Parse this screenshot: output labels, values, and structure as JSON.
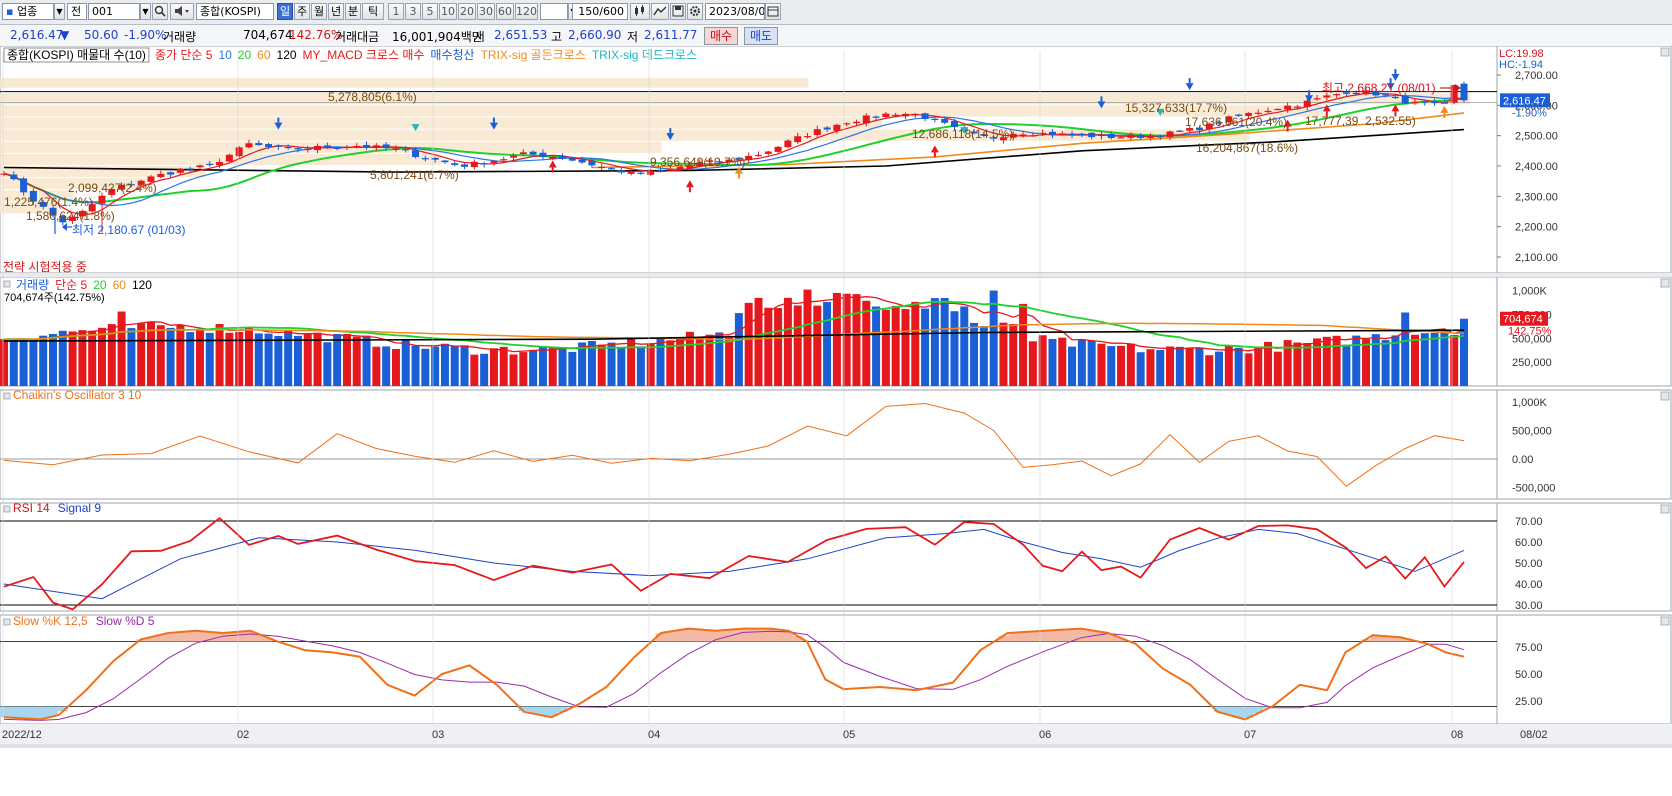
{
  "toolbar": {
    "market_type": "업종",
    "period_type": "전",
    "code": "001",
    "name": "종합(KOSPI)",
    "periods": [
      "일",
      "주",
      "월",
      "년",
      "분",
      "틱"
    ],
    "active_period": "일",
    "intervals": [
      "1",
      "3",
      "5",
      "10",
      "20",
      "30",
      "60",
      "120"
    ],
    "count": "150/600",
    "date": "2023/08/02",
    "icons": [
      "search-icon",
      "speaker-icon",
      "candle-type-icon",
      "link-icon",
      "save-icon",
      "gear-icon",
      "calendar-icon"
    ]
  },
  "quote": {
    "price": "2,616.47",
    "change_arrow": "▼",
    "change": "50.60",
    "change_pct": "-1.90%",
    "volume_label": "거래량",
    "volume": "704,674",
    "volume_ratio": "142.76%",
    "amount_label": "거래대금",
    "amount": "16,001,904백만",
    "open_label": "시",
    "open": "2,651.53",
    "high_label": "고",
    "high": "2,660.90",
    "low_label": "저",
    "low": "2,611.77",
    "buy_label": "매수",
    "sell_label": "매도"
  },
  "colors": {
    "up": "#e5191d",
    "down": "#1a5fd6",
    "ma5": "#e5191d",
    "ma10": "#2c72e6",
    "ma20": "#22d02c",
    "ma60": "#f08a1a",
    "ma120": "#000000",
    "profile": "#f7e6cc",
    "text_brown": "#7a4a10"
  },
  "price_panel": {
    "legend": [
      {
        "text": "종합(KOSPI) 매물대 수(10)",
        "color": "#000000",
        "boxed": true
      },
      {
        "text": "종가 단순 5",
        "color": "#e5191d"
      },
      {
        "text": "10",
        "color": "#2c72e6"
      },
      {
        "text": "20",
        "color": "#22d02c"
      },
      {
        "text": "60",
        "color": "#f08a1a"
      },
      {
        "text": "120",
        "color": "#000000"
      },
      {
        "text": "MY_MACD 크로스 매수",
        "color": "#e5191d"
      },
      {
        "text": "매수청산",
        "color": "#1a5fd6"
      },
      {
        "text": "TRIX-sig 골든크로스",
        "color": "#f08a1a"
      },
      {
        "text": "TRIX-sig 데드크로스",
        "color": "#21b5bd"
      }
    ],
    "axis_ticks": [
      "2,700.00",
      "2,600.00",
      "2,500.00",
      "2,400.00",
      "2,300.00",
      "2,200.00",
      "2,100.00"
    ],
    "lc": "LC:19.98",
    "hc": "HC:-1.94",
    "current_price": "2,616.47",
    "current_pct": "-1.90%",
    "high_note": "최고 2,668.21 (08/01)",
    "low_note": "최저 2,180.67 (01/03)",
    "strategy_text": "전략 시험적용 중",
    "profile_labels": [
      "5,278,805(6.1%)",
      "15,327,633(17.7%)",
      "17,636,661(20.4%)",
      "17,777,39",
      "2,532.55)",
      "12,686,118(14.5%)",
      "9,356,649(10.7%)",
      "16,204,867(18.6%)",
      "5,801,241(6.7%)",
      "2,099,427(2.4%)",
      "1,225,476(1.4%)",
      "1,580,624(1.8%)"
    ]
  },
  "volume_panel": {
    "legend": [
      {
        "text": "거래량",
        "color": "#1a5fd6"
      },
      {
        "text": "단순 5",
        "color": "#e5191d"
      },
      {
        "text": "20",
        "color": "#22d02c"
      },
      {
        "text": "60",
        "color": "#f08a1a"
      },
      {
        "text": "120",
        "color": "#000000"
      }
    ],
    "info": "704,674주(142.75%)",
    "axis_ticks": [
      "1,000K",
      "750,000",
      "500,000",
      "250,000"
    ],
    "current_value": "704,674",
    "current_pct": "142.75%"
  },
  "chaikin_panel": {
    "legend": "Chaikin's Oscillator 3 10",
    "axis_ticks": [
      "1,000K",
      "500,000",
      "0.00",
      "-500,000"
    ]
  },
  "rsi_panel": {
    "legend": [
      {
        "text": "RSI 14",
        "color": "#d8141b"
      },
      {
        "text": "Signal 9",
        "color": "#1c43c8"
      }
    ],
    "axis_ticks": [
      "70.00",
      "60.00",
      "50.00",
      "40.00",
      "30.00"
    ]
  },
  "stoch_panel": {
    "legend": [
      {
        "text": "Slow %K 12,5",
        "color": "#f07018"
      },
      {
        "text": "Slow %D 5",
        "color": "#9a2aa8"
      }
    ],
    "axis_ticks": [
      "75.00",
      "50.00",
      "25.00"
    ]
  },
  "x_axis": {
    "labels": [
      "2022/12",
      "02",
      "03",
      "04",
      "05",
      "06",
      "07",
      "08"
    ],
    "last_label": "08/02"
  },
  "chart_data": {
    "type": "candlestick",
    "note": "KOSPI daily Dec 2022 - Aug 2023",
    "price_range": [
      2080,
      2720
    ],
    "key_points": [
      {
        "x": "2022/12",
        "close": 2380
      },
      {
        "x": "01/03",
        "low": 2180.67
      },
      {
        "x": "02",
        "close": 2470
      },
      {
        "x": "03",
        "close": 2420
      },
      {
        "x": "04",
        "close": 2570
      },
      {
        "x": "05",
        "close": 2500
      },
      {
        "x": "06",
        "close": 2640
      },
      {
        "x": "07",
        "close": 2600
      },
      {
        "x": "08/01",
        "high": 2668.21
      },
      {
        "x": "08/02",
        "close": 2616.47
      }
    ],
    "rsi_range": [
      25,
      75
    ],
    "stoch_range": [
      0,
      100
    ]
  }
}
